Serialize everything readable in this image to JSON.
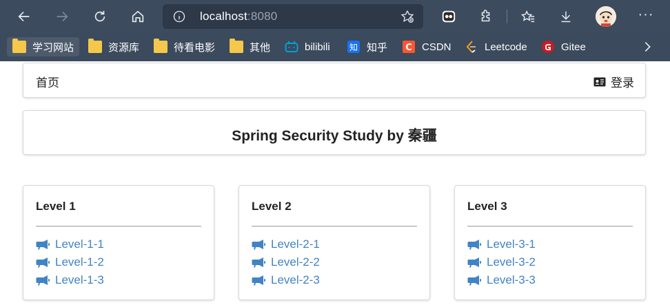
{
  "browser": {
    "url_host": "localhost",
    "url_port": ":8080",
    "bookmarks": [
      {
        "label": "学习网站",
        "icon": "folder-icon"
      },
      {
        "label": "资源库",
        "icon": "folder-icon"
      },
      {
        "label": "待看电影",
        "icon": "folder-icon"
      },
      {
        "label": "其他",
        "icon": "folder-icon"
      },
      {
        "label": "bilibili",
        "icon": "bilibili-icon"
      },
      {
        "label": "知乎",
        "icon": "zhihu-icon"
      },
      {
        "label": "CSDN",
        "icon": "csdn-icon"
      },
      {
        "label": "Leetcode",
        "icon": "leetcode-icon"
      },
      {
        "label": "Gitee",
        "icon": "gitee-icon"
      }
    ],
    "colors": {
      "chrome": "#3b4a5c",
      "folder": "#f5c84c",
      "zhihu": "#1772f6",
      "csdn": "#fc5531",
      "gitee": "#c71d23",
      "bilibili": "#00a1d6"
    }
  },
  "menu": {
    "home": "首页",
    "login": "登录"
  },
  "title": "Spring Security Study by 秦疆",
  "levels": [
    {
      "title": "Level 1",
      "links": [
        "Level-1-1",
        "Level-1-2",
        "Level-1-3"
      ]
    },
    {
      "title": "Level 2",
      "links": [
        "Level-2-1",
        "Level-2-2",
        "Level-2-3"
      ]
    },
    {
      "title": "Level 3",
      "links": [
        "Level-3-1",
        "Level-3-2",
        "Level-3-3"
      ]
    }
  ],
  "link_color": "#4183c4"
}
